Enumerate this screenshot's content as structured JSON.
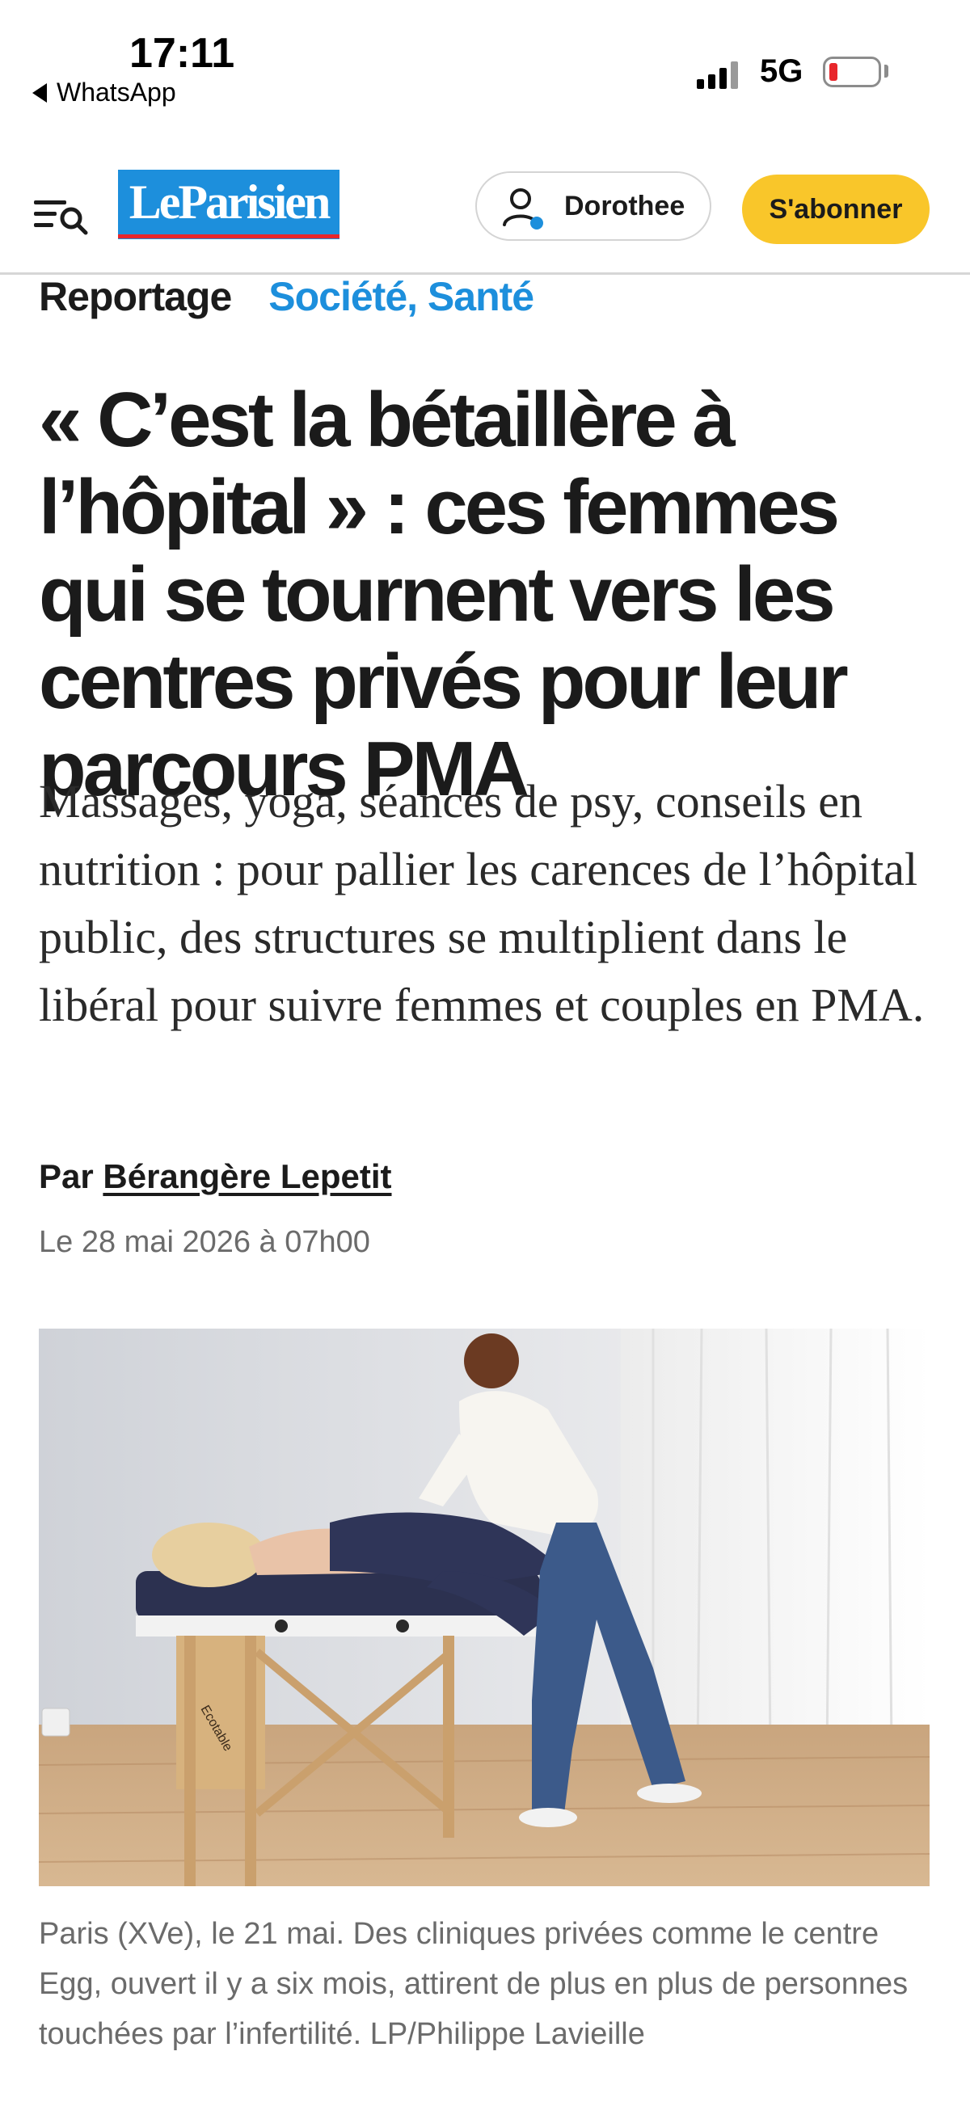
{
  "status_bar": {
    "time": "17:11",
    "back_app": "WhatsApp",
    "network": "5G",
    "battery_color": "#e8262b"
  },
  "header": {
    "logo": "LeParisien",
    "user_name": "Dorothee",
    "subscribe_label": "S'abonner",
    "brand_blue": "#1d8fdc",
    "subscribe_color": "#f9c62a"
  },
  "article": {
    "kicker_type": "Reportage",
    "kicker_category": "Société, Santé",
    "headline": "« C’est la bétaillère à l’hôpital » : ces femmes qui se tournent vers les centres privés pour leur parcours PMA",
    "lede": "Massages, yoga, séances de psy, conseils en nutrition : pour pallier les carences de l’hôpital public, des structures se multiplient dans le libéral pour suivre femmes et couples en PMA.",
    "byline_prefix": "Par",
    "author": "Bérangère Lepetit",
    "date": "Le 28 mai 2026 à 07h00",
    "photo_caption": "Paris (XVe), le 21 mai. Des cliniques privées comme le centre Egg, ouvert il y a six mois, attirent de plus en plus de personnes touchées par l’infertilité. LP/Philippe Lavieille",
    "massage_table_brand": "Ecotable"
  }
}
